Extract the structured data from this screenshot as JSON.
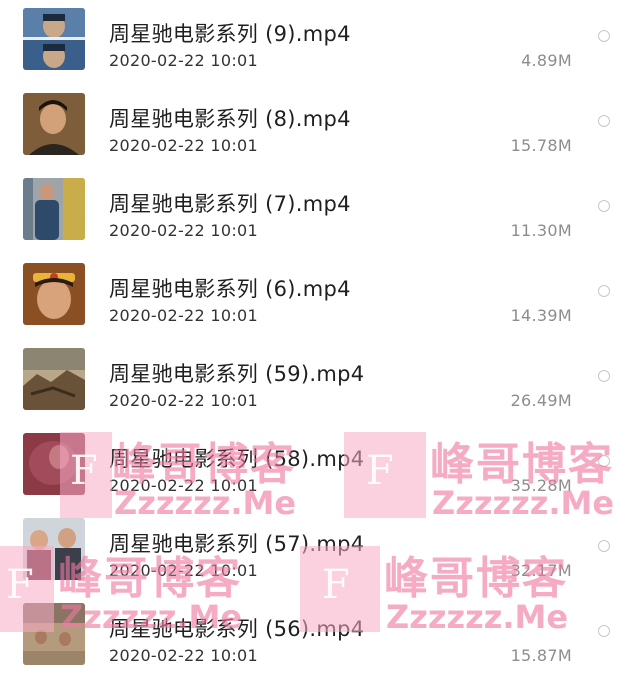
{
  "files": [
    {
      "name": "周星驰电影系列 (9).mp4",
      "date": "2020-02-22 10:01",
      "size": "4.89M",
      "thumb": "thumbnail-pair-of-faces"
    },
    {
      "name": "周星驰电影系列 (8).mp4",
      "date": "2020-02-22 10:01",
      "size": "15.78M",
      "thumb": "thumbnail-man-portrait"
    },
    {
      "name": "周星驰电影系列 (7).mp4",
      "date": "2020-02-22 10:01",
      "size": "11.30M",
      "thumb": "thumbnail-standing-man"
    },
    {
      "name": "周星驰电影系列 (6).mp4",
      "date": "2020-02-22 10:01",
      "size": "14.39M",
      "thumb": "thumbnail-monkey-king-headband"
    },
    {
      "name": "周星驰电影系列 (59).mp4",
      "date": "2020-02-22 10:01",
      "size": "26.49M",
      "thumb": "thumbnail-ruins-landscape"
    },
    {
      "name": "周星驰电影系列 (58).mp4",
      "date": "2020-02-22 10:01",
      "size": "35.28M",
      "thumb": "thumbnail-red-scene"
    },
    {
      "name": "周星驰电影系列 (57).mp4",
      "date": "2020-02-22 10:01",
      "size": "32.17M",
      "thumb": "thumbnail-group-of-people"
    },
    {
      "name": "周星驰电影系列 (56).mp4",
      "date": "2020-02-22 10:01",
      "size": "15.87M",
      "thumb": "thumbnail-street-scene"
    }
  ],
  "watermark": {
    "letter": "F",
    "title": "峰哥博客",
    "url": "Zzzzzz.Me"
  },
  "colors": {
    "watermark_pink": "#f7aac4",
    "size_gray": "#8d8d8d",
    "radio_border": "#c8c8c8"
  }
}
